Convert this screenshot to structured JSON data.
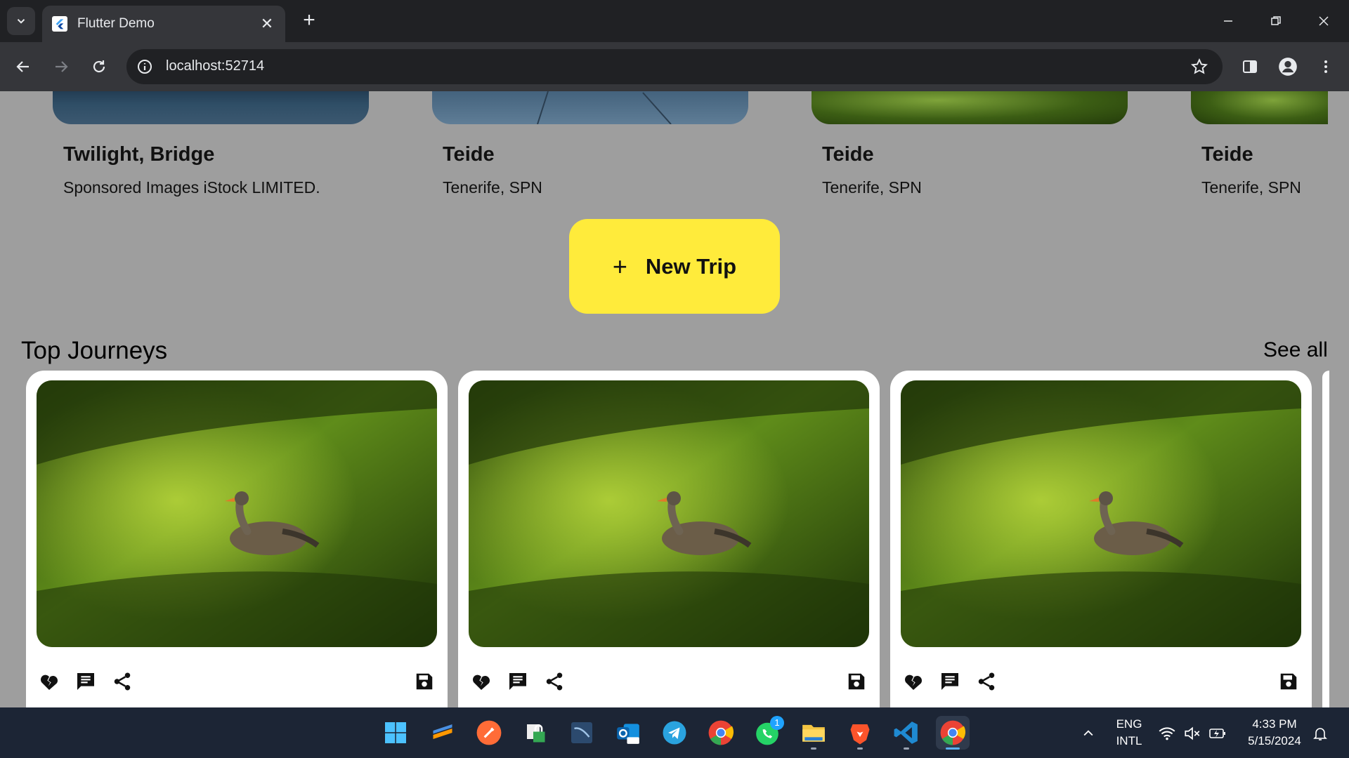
{
  "browser": {
    "tab_title": "Flutter Demo",
    "url": "localhost:52714"
  },
  "destinations": [
    {
      "title": "Twilight, Bridge",
      "subtitle": "Sponsored Images iStock LIMITED."
    },
    {
      "title": "Teide",
      "subtitle": "Tenerife, SPN"
    },
    {
      "title": "Teide",
      "subtitle": "Tenerife, SPN"
    },
    {
      "title": "Teide",
      "subtitle": "Tenerife, SPN"
    }
  ],
  "new_trip": {
    "label": "New Trip",
    "icon": "plus-icon"
  },
  "top_journeys": {
    "title": "Top Journeys",
    "see_all": "See all",
    "cards": [
      {
        "image": "goose-in-grass",
        "actions": [
          "heart-broken-icon",
          "comment-icon",
          "share-icon",
          "save-icon"
        ]
      },
      {
        "image": "goose-in-grass",
        "actions": [
          "heart-broken-icon",
          "comment-icon",
          "share-icon",
          "save-icon"
        ]
      },
      {
        "image": "goose-in-grass",
        "actions": [
          "heart-broken-icon",
          "comment-icon",
          "share-icon",
          "save-icon"
        ]
      }
    ]
  },
  "taskbar": {
    "language_top": "ENG",
    "language_bottom": "INTL",
    "time": "4:33 PM",
    "date": "5/15/2024",
    "whatsapp_badge": "1"
  },
  "colors": {
    "page_bg": "#9e9e9e",
    "new_trip_bg": "#ffeb3b",
    "card_bg": "#ffffff",
    "browser_dark": "#202124",
    "taskbar_bg": "#1c2535"
  }
}
